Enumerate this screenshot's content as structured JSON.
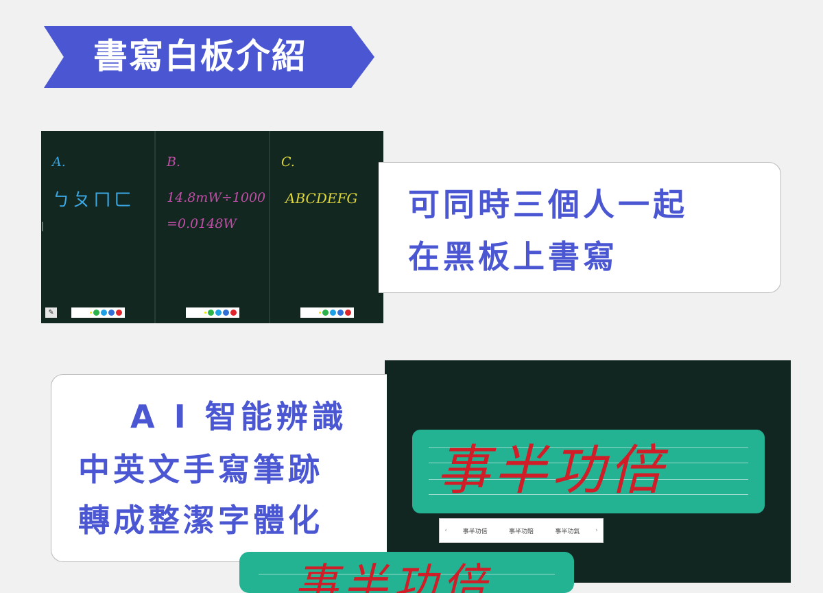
{
  "header": {
    "title": "書寫白板介紹"
  },
  "boards": [
    {
      "label": "A.",
      "color": "#3aa7e3",
      "lines": [
        "ㄅㄆㄇㄈ"
      ]
    },
    {
      "label": "B.",
      "color": "#c04ea6",
      "lines": [
        "14.8mW÷1000",
        "=0.0148W"
      ]
    },
    {
      "label": "C.",
      "color": "#dfd73a",
      "lines": [
        "ABCDEFG"
      ]
    }
  ],
  "palette_colors": [
    "#f2e500",
    "#2bb34a",
    "#1ea0e6",
    "#2f6fd6",
    "#e0242b"
  ],
  "card1": {
    "line1": "可同時三個人一起",
    "line2": "在黑板上書寫"
  },
  "card2": {
    "line1": "A I 智能辨識",
    "line2": "中英文手寫筆跡",
    "line3": "轉成整潔字體化"
  },
  "handwriting": {
    "text": "事半功倍"
  },
  "suggestions": [
    "事半功倍",
    "事半功賠",
    "事半功氣"
  ],
  "result": {
    "text": "事半功倍"
  },
  "colors": {
    "accent": "#4b57d2",
    "board": "#122720",
    "pad": "#23b393",
    "ink": "#d11d27"
  }
}
